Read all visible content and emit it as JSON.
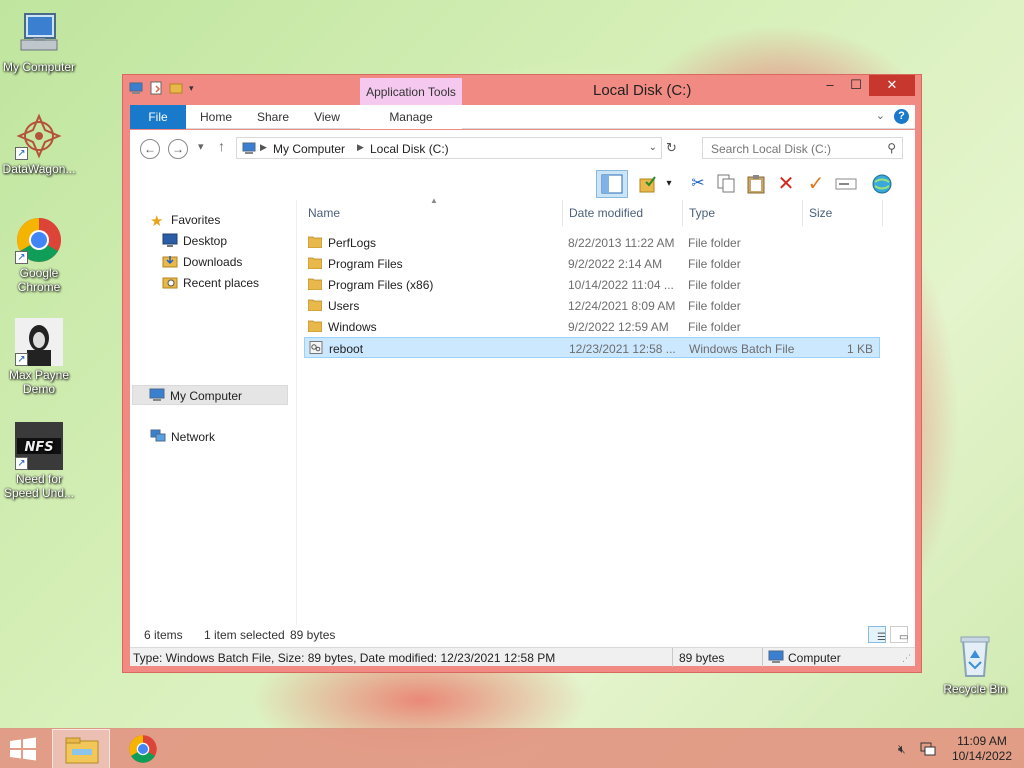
{
  "desktop": {
    "icons": [
      {
        "label": "My Computer"
      },
      {
        "label": "DataWagon..."
      },
      {
        "label": "Google Chrome"
      },
      {
        "label": "Max Payne Demo"
      },
      {
        "label": "Need for Speed Und..."
      },
      {
        "label": "Recycle Bin"
      }
    ]
  },
  "window": {
    "title": "Local Disk (C:)",
    "context_tab": "Application Tools",
    "ribbon_tabs": [
      "File",
      "Home",
      "Share",
      "View",
      "Manage"
    ],
    "controls": {
      "minimize": "–",
      "maximize": "☐",
      "close": "✕"
    }
  },
  "navigation": {
    "breadcrumb": [
      "My Computer",
      "Local Disk (C:)"
    ],
    "search_placeholder": "Search Local Disk (C:)"
  },
  "nav_pane": {
    "favorites_label": "Favorites",
    "favorites": [
      "Desktop",
      "Downloads",
      "Recent places"
    ],
    "computer_label": "My Computer",
    "network_label": "Network"
  },
  "columns": [
    "Name",
    "Date modified",
    "Type",
    "Size"
  ],
  "files": [
    {
      "name": "PerfLogs",
      "date": "8/22/2013 11:22 AM",
      "type": "File folder",
      "size": "",
      "kind": "folder"
    },
    {
      "name": "Program Files",
      "date": "9/2/2022 2:14 AM",
      "type": "File folder",
      "size": "",
      "kind": "folder"
    },
    {
      "name": "Program Files (x86)",
      "date": "10/14/2022 11:04 ...",
      "type": "File folder",
      "size": "",
      "kind": "folder"
    },
    {
      "name": "Users",
      "date": "12/24/2021 8:09 AM",
      "type": "File folder",
      "size": "",
      "kind": "folder"
    },
    {
      "name": "Windows",
      "date": "9/2/2022 12:59 AM",
      "type": "File folder",
      "size": "",
      "kind": "folder"
    },
    {
      "name": "reboot",
      "date": "12/23/2021 12:58 ...",
      "type": "Windows Batch File",
      "size": "1 KB",
      "kind": "batch"
    }
  ],
  "info_bar": {
    "item_count": "6 items",
    "selection": "1 item selected",
    "selection_size": "89 bytes"
  },
  "status_bar": {
    "details": "Type: Windows Batch File, Size: 89 bytes, Date modified: 12/23/2021 12:58 PM",
    "size": "89 bytes",
    "location": "Computer"
  },
  "taskbar": {
    "time": "11:09 AM",
    "date": "10/14/2022"
  },
  "colors": {
    "window_frame": "#f08a82",
    "close_button": "#c7372e",
    "file_tab": "#1979ca",
    "context_tab": "#f5c9ef",
    "selection": "#cce8ff",
    "folder": "#e8b84a"
  }
}
